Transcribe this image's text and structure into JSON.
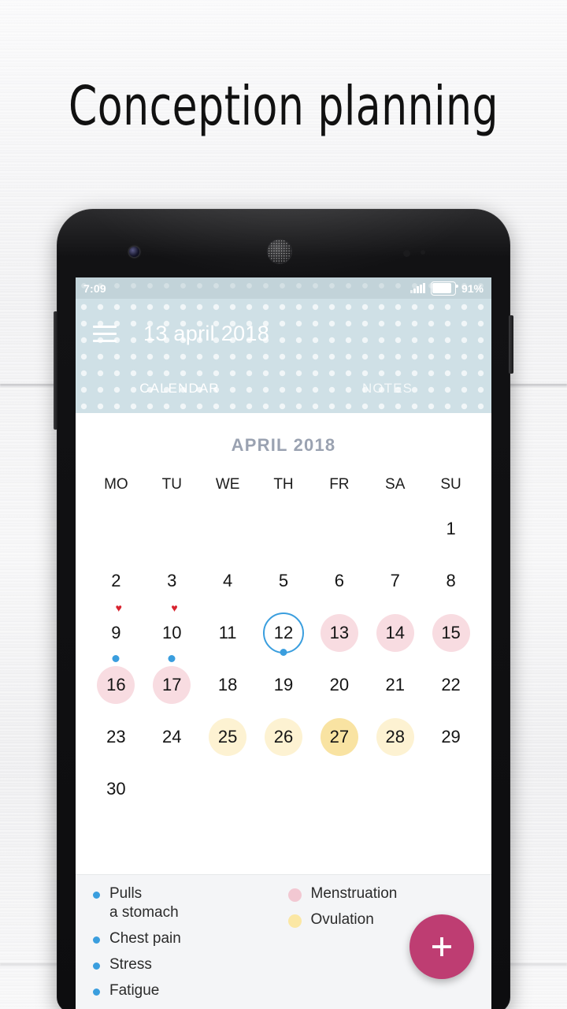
{
  "poster": {
    "headline": "Conception planning",
    "background_color": "#f3f3f4"
  },
  "status_bar": {
    "time": "7:09",
    "battery_percent": "91%",
    "signal_icon": "signal-bars-icon",
    "battery_icon": "battery-icon"
  },
  "app_bar": {
    "menu_icon": "hamburger-menu-icon",
    "title": "13 april 2018",
    "background_color": "#cfe0e6",
    "tabs": [
      {
        "label": "CALENDAR",
        "active": true
      },
      {
        "label": "NOTES",
        "active": false
      }
    ]
  },
  "calendar": {
    "month_label": "APRIL 2018",
    "weekdays": [
      "MO",
      "TU",
      "WE",
      "TH",
      "FR",
      "SA",
      "SU"
    ],
    "weeks": [
      [
        {
          "day": ""
        },
        {
          "day": ""
        },
        {
          "day": ""
        },
        {
          "day": ""
        },
        {
          "day": ""
        },
        {
          "day": ""
        },
        {
          "day": "1"
        }
      ],
      [
        {
          "day": "2"
        },
        {
          "day": "3"
        },
        {
          "day": "4"
        },
        {
          "day": "5"
        },
        {
          "day": "6"
        },
        {
          "day": "7"
        },
        {
          "day": "8"
        }
      ],
      [
        {
          "day": "9",
          "heart": true,
          "dot": true
        },
        {
          "day": "10",
          "heart": true,
          "dot": true
        },
        {
          "day": "11"
        },
        {
          "day": "12",
          "selected": true,
          "dot_edge": true
        },
        {
          "day": "13",
          "state": "menstruation"
        },
        {
          "day": "14",
          "state": "menstruation"
        },
        {
          "day": "15",
          "state": "menstruation"
        }
      ],
      [
        {
          "day": "16",
          "state": "menstruation"
        },
        {
          "day": "17",
          "state": "menstruation"
        },
        {
          "day": "18"
        },
        {
          "day": "19"
        },
        {
          "day": "20"
        },
        {
          "day": "21"
        },
        {
          "day": "22"
        }
      ],
      [
        {
          "day": "23"
        },
        {
          "day": "24"
        },
        {
          "day": "25",
          "state": "ovulation-light"
        },
        {
          "day": "26",
          "state": "ovulation-light"
        },
        {
          "day": "27",
          "state": "ovulation-strong"
        },
        {
          "day": "28",
          "state": "ovulation-light"
        },
        {
          "day": "29"
        }
      ],
      [
        {
          "day": "30"
        },
        {
          "day": ""
        },
        {
          "day": ""
        },
        {
          "day": ""
        },
        {
          "day": ""
        },
        {
          "day": ""
        },
        {
          "day": ""
        }
      ]
    ],
    "colors": {
      "menstruation": "#f8dce1",
      "ovulation_light": "#fdf2d2",
      "ovulation_strong": "#f9e3a2",
      "selected_ring": "#3a9ede",
      "symptom_dot": "#3a9ede",
      "heart": "#d8232f",
      "month_label": "#9aa2b1"
    }
  },
  "legend": {
    "symptoms": [
      {
        "line1": "Pulls",
        "line2": "a stomach"
      },
      {
        "line1": "Chest pain",
        "line2": ""
      },
      {
        "line1": "Stress",
        "line2": ""
      },
      {
        "line1": "Fatigue",
        "line2": ""
      }
    ],
    "phases": [
      {
        "label": "Menstruation",
        "color": "#f2c8d2"
      },
      {
        "label": "Ovulation",
        "color": "#fbe7a4"
      }
    ]
  },
  "fab": {
    "icon": "plus-icon",
    "color": "#be3d72",
    "label": "+"
  }
}
